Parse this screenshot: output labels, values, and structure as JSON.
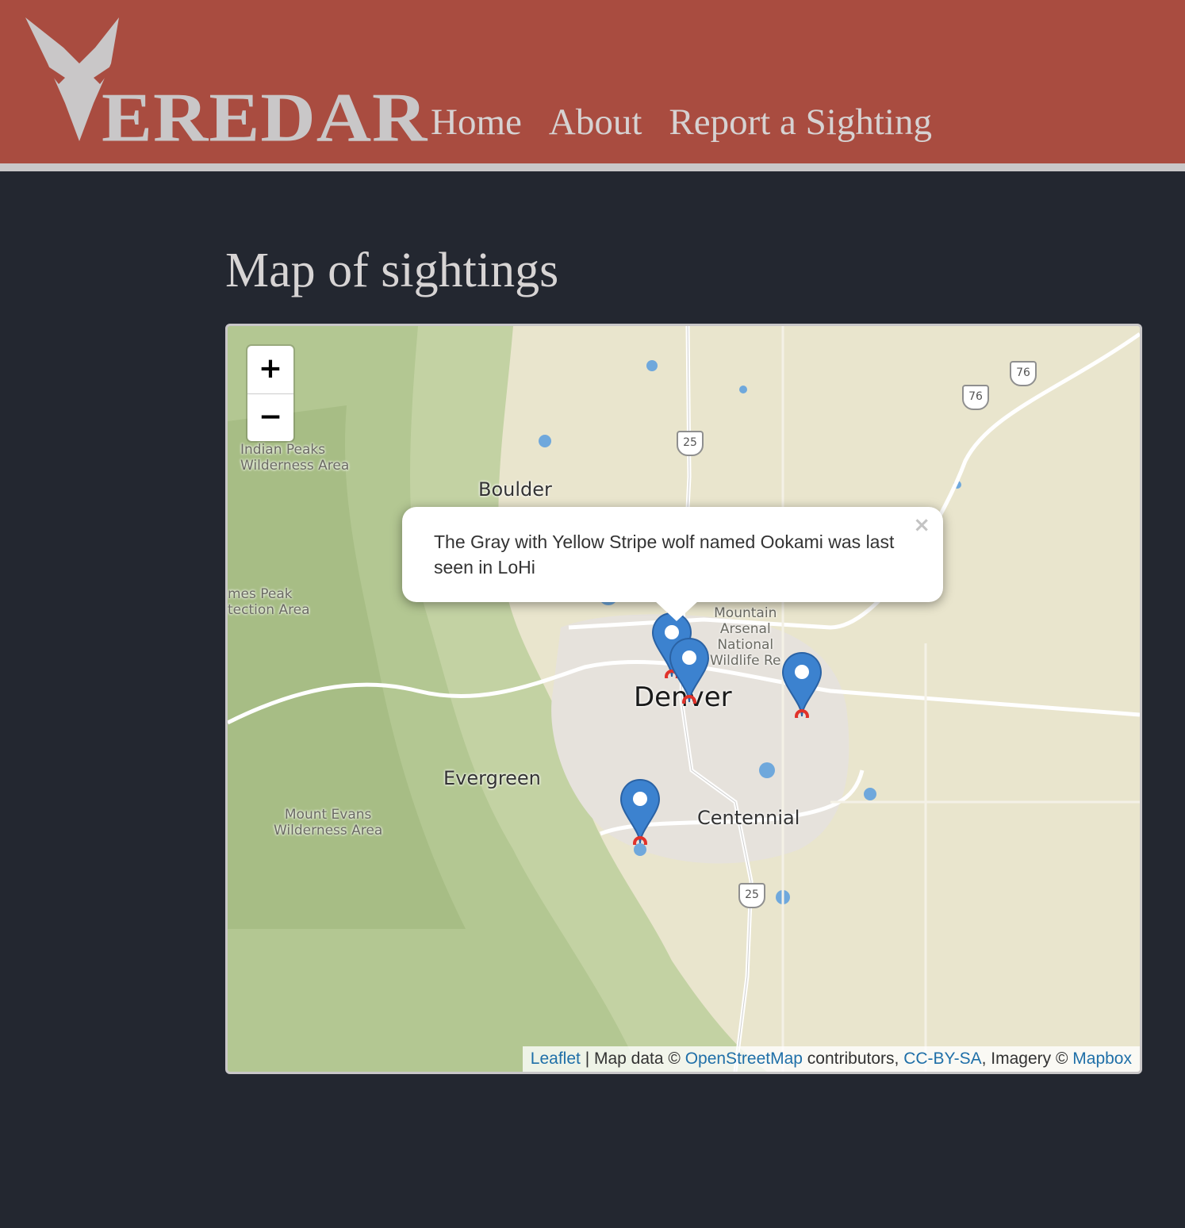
{
  "header": {
    "logo_text": "EREDAR",
    "nav": {
      "home": "Home",
      "about": "About",
      "report": "Report a Sighting"
    },
    "colors": {
      "bar": "#a94c40",
      "logo": "#c9c7c8"
    }
  },
  "main": {
    "title": "Map of sightings"
  },
  "map": {
    "zoom_in": "+",
    "zoom_out": "−",
    "places": {
      "indian_peaks": "Indian Peaks\nWilderness Area",
      "boulder": "Boulder",
      "james_peak": "mes Peak\ntection Area",
      "mountain_arsenal": "Mountain\nArsenal\nNational\nWildlife Re",
      "denver": "Denver",
      "evergreen": "Evergreen",
      "mount_evans": "Mount Evans\nWilderness Area",
      "centennial": "Centennial"
    },
    "shields": {
      "i25_north": "25",
      "i76_a": "76",
      "i76_b": "76",
      "i25_south": "25"
    },
    "popup": {
      "text": "The Gray with Yellow Stripe wolf named Ookami was last seen in LoHi",
      "close": "×"
    },
    "attribution": {
      "leaflet": "Leaflet",
      "sep": " | Map data © ",
      "osm": "OpenStreetMap",
      "contributors": " contributors, ",
      "license": "CC-BY-SA",
      "imagery": ", Imagery © ",
      "mapbox": "Mapbox"
    }
  }
}
